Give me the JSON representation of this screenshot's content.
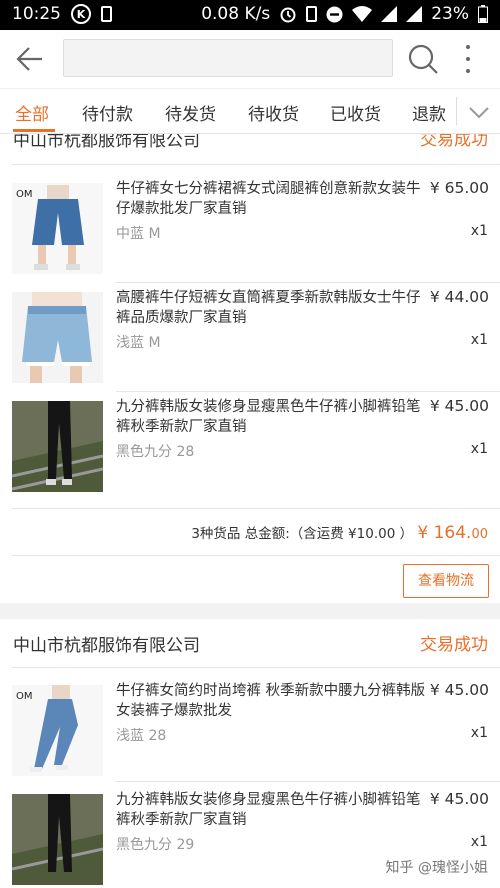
{
  "statusbar": {
    "time": "10:25",
    "k_badge": "K",
    "speed": "0.08 K/s",
    "battery": "23%"
  },
  "header": {
    "search_placeholder": "",
    "back_icon": "arrow-left-icon",
    "search_icon": "search-icon",
    "more_icon": "more-vert-icon"
  },
  "tabs": [
    {
      "label": "全部",
      "active": true
    },
    {
      "label": "待付款"
    },
    {
      "label": "待发货"
    },
    {
      "label": "待收货"
    },
    {
      "label": "已收货"
    },
    {
      "label": "退款"
    }
  ],
  "orders": [
    {
      "shop": "中山市杭都服饰有限公司",
      "status": "交易成功",
      "items": [
        {
          "title": "牛仔裤女七分裤裙裤女式阔腿裤创意新款女装牛仔爆款批发厂家直销",
          "spec": "中蓝 M",
          "price": "¥ 65.00",
          "qty": "x1"
        },
        {
          "title": "高腰裤牛仔短裤女直筒裤夏季新款韩版女士牛仔裤品质爆款厂家直销",
          "spec": "浅蓝 M",
          "price": "¥ 44.00",
          "qty": "x1"
        },
        {
          "title": "九分裤韩版女装修身显瘦黑色牛仔裤小脚裤铅笔裤秋季新款厂家直销",
          "spec": "黑色九分 28",
          "price": "¥ 45.00",
          "qty": "x1"
        }
      ],
      "summary_label": "3种货品 总金额:（含运费 ¥10.00 ）",
      "total_int": "¥ 164.",
      "total_dec": "00",
      "logistics_label": "查看物流"
    },
    {
      "shop": "中山市杭都服饰有限公司",
      "status": "交易成功",
      "items": [
        {
          "title": "牛仔裤女简约时尚垮裤 秋季新款中腰九分裤韩版女装裤子爆款批发",
          "spec": "浅蓝 28",
          "price": "¥ 45.00",
          "qty": "x1"
        },
        {
          "title": "九分裤韩版女装修身显瘦黑色牛仔裤小脚裤铅笔裤秋季新款厂家直销",
          "spec": "黑色九分 29",
          "price": "¥ 45.00",
          "qty": "x1"
        }
      ]
    }
  ],
  "watermark": "知乎 @瑰怪小姐",
  "colors": {
    "accent": "#e8702a",
    "muted": "#999999"
  }
}
